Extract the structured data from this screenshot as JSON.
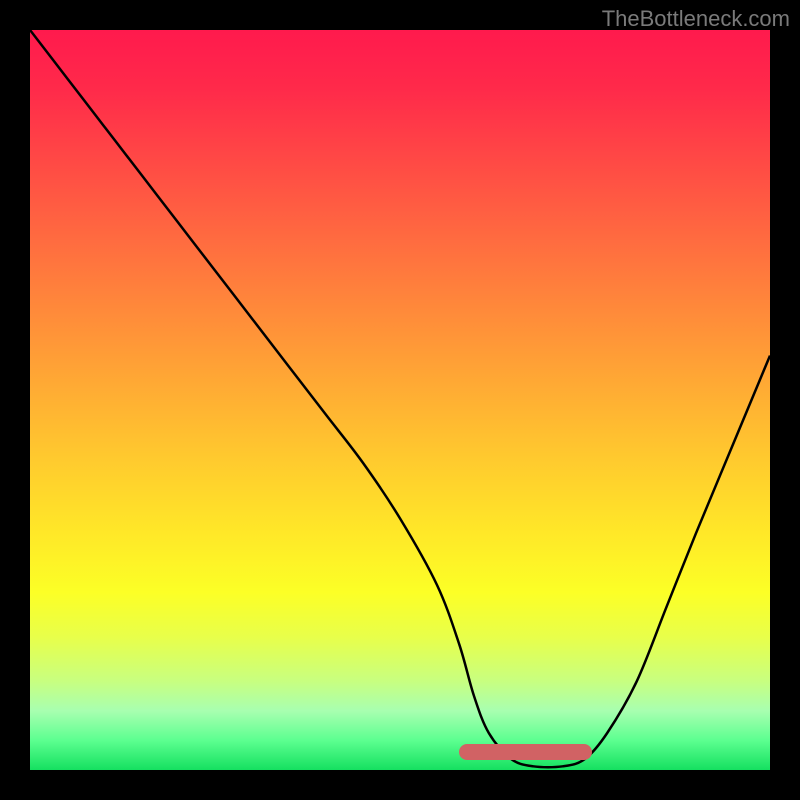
{
  "watermark": "TheBottleneck.com",
  "chart_data": {
    "type": "line",
    "title": "",
    "xlabel": "",
    "ylabel": "",
    "xlim": [
      0,
      100
    ],
    "ylim": [
      0,
      100
    ],
    "x": [
      0,
      5,
      10,
      15,
      20,
      25,
      30,
      35,
      40,
      45,
      50,
      55,
      58,
      60,
      62,
      65,
      68,
      72,
      75,
      78,
      82,
      86,
      90,
      95,
      100
    ],
    "values": [
      100,
      93.5,
      87,
      80.5,
      74,
      67.5,
      61,
      54.5,
      48,
      41.5,
      34,
      25,
      17,
      10,
      5,
      1.5,
      0.5,
      0.5,
      1.5,
      5,
      12,
      22,
      32,
      44,
      56
    ],
    "series": [
      {
        "name": "bottleneck-curve",
        "color": "#000000"
      }
    ],
    "optimal_region": {
      "x_start": 58,
      "x_end": 76,
      "color": "#d16264"
    },
    "background_gradient": {
      "top": "#ff1a4d",
      "mid": "#ffe828",
      "bottom": "#15e060"
    }
  }
}
